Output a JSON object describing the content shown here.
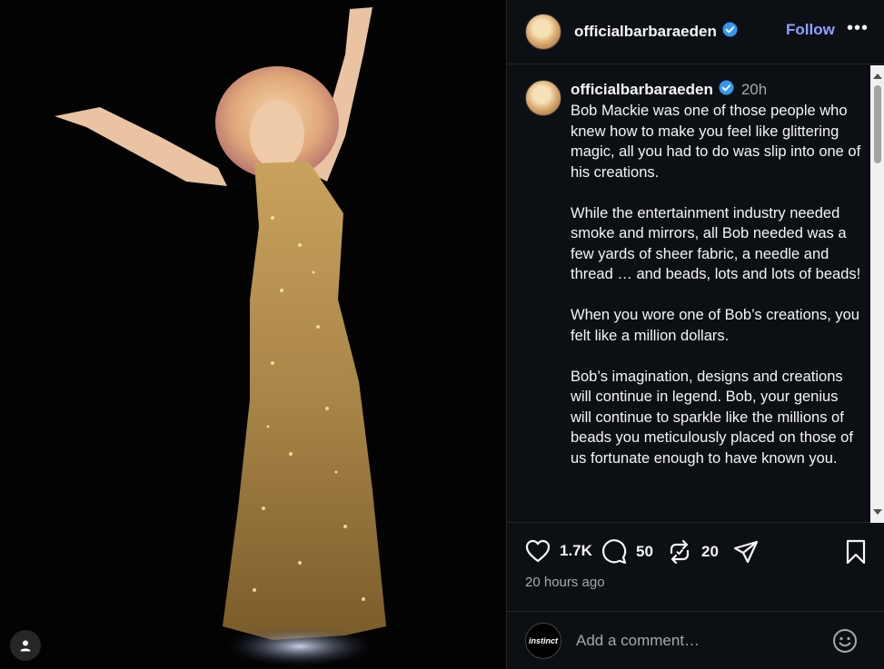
{
  "post": {
    "username": "officialbarbaraeden",
    "verified_icon": "verified-badge-icon",
    "follow_label": "Follow",
    "more_label": "•••",
    "caption_time": "20h",
    "caption_paragraphs": [
      "Bob Mackie was one of those people who knew how to make you feel like glittering magic, all you had to do was slip into one of his creations.",
      "While the entertainment industry needed smoke and mirrors, all Bob needed was a few yards of sheer fabric, a needle and thread … and beads, lots and lots of beads!",
      "When you wore one of Bob’s creations, you felt like a million dollars.",
      "Bob’s imagination, designs and creations will continue in legend. Bob, your genius will continue to sparkle like the millions of beads you meticulously placed on those of us fortunate enough to have known you."
    ],
    "likes": "1.7K",
    "comments": "50",
    "reposts": "20",
    "posted_ago": "20 hours ago"
  },
  "comment": {
    "avatar_text": "instinct",
    "placeholder": "Add a comment…"
  },
  "colors": {
    "panel_bg": "#0c1014",
    "follow": "#8ca0ff",
    "verified": "#3797f0",
    "muted": "#a8a8a8"
  }
}
